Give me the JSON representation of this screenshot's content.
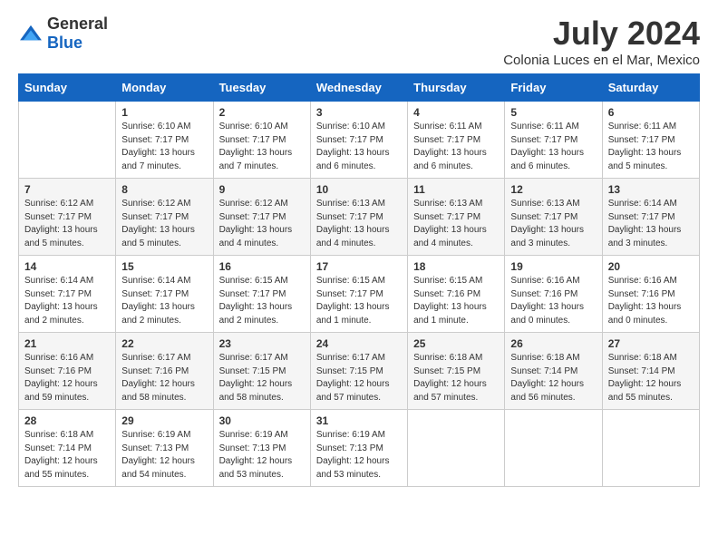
{
  "logo": {
    "general": "General",
    "blue": "Blue"
  },
  "header": {
    "month": "July 2024",
    "location": "Colonia Luces en el Mar, Mexico"
  },
  "weekdays": [
    "Sunday",
    "Monday",
    "Tuesday",
    "Wednesday",
    "Thursday",
    "Friday",
    "Saturday"
  ],
  "weeks": [
    [
      {
        "day": null,
        "sunrise": null,
        "sunset": null,
        "daylight": null
      },
      {
        "day": "1",
        "sunrise": "Sunrise: 6:10 AM",
        "sunset": "Sunset: 7:17 PM",
        "daylight": "Daylight: 13 hours and 7 minutes."
      },
      {
        "day": "2",
        "sunrise": "Sunrise: 6:10 AM",
        "sunset": "Sunset: 7:17 PM",
        "daylight": "Daylight: 13 hours and 7 minutes."
      },
      {
        "day": "3",
        "sunrise": "Sunrise: 6:10 AM",
        "sunset": "Sunset: 7:17 PM",
        "daylight": "Daylight: 13 hours and 6 minutes."
      },
      {
        "day": "4",
        "sunrise": "Sunrise: 6:11 AM",
        "sunset": "Sunset: 7:17 PM",
        "daylight": "Daylight: 13 hours and 6 minutes."
      },
      {
        "day": "5",
        "sunrise": "Sunrise: 6:11 AM",
        "sunset": "Sunset: 7:17 PM",
        "daylight": "Daylight: 13 hours and 6 minutes."
      },
      {
        "day": "6",
        "sunrise": "Sunrise: 6:11 AM",
        "sunset": "Sunset: 7:17 PM",
        "daylight": "Daylight: 13 hours and 5 minutes."
      }
    ],
    [
      {
        "day": "7",
        "sunrise": "Sunrise: 6:12 AM",
        "sunset": "Sunset: 7:17 PM",
        "daylight": "Daylight: 13 hours and 5 minutes."
      },
      {
        "day": "8",
        "sunrise": "Sunrise: 6:12 AM",
        "sunset": "Sunset: 7:17 PM",
        "daylight": "Daylight: 13 hours and 5 minutes."
      },
      {
        "day": "9",
        "sunrise": "Sunrise: 6:12 AM",
        "sunset": "Sunset: 7:17 PM",
        "daylight": "Daylight: 13 hours and 4 minutes."
      },
      {
        "day": "10",
        "sunrise": "Sunrise: 6:13 AM",
        "sunset": "Sunset: 7:17 PM",
        "daylight": "Daylight: 13 hours and 4 minutes."
      },
      {
        "day": "11",
        "sunrise": "Sunrise: 6:13 AM",
        "sunset": "Sunset: 7:17 PM",
        "daylight": "Daylight: 13 hours and 4 minutes."
      },
      {
        "day": "12",
        "sunrise": "Sunrise: 6:13 AM",
        "sunset": "Sunset: 7:17 PM",
        "daylight": "Daylight: 13 hours and 3 minutes."
      },
      {
        "day": "13",
        "sunrise": "Sunrise: 6:14 AM",
        "sunset": "Sunset: 7:17 PM",
        "daylight": "Daylight: 13 hours and 3 minutes."
      }
    ],
    [
      {
        "day": "14",
        "sunrise": "Sunrise: 6:14 AM",
        "sunset": "Sunset: 7:17 PM",
        "daylight": "Daylight: 13 hours and 2 minutes."
      },
      {
        "day": "15",
        "sunrise": "Sunrise: 6:14 AM",
        "sunset": "Sunset: 7:17 PM",
        "daylight": "Daylight: 13 hours and 2 minutes."
      },
      {
        "day": "16",
        "sunrise": "Sunrise: 6:15 AM",
        "sunset": "Sunset: 7:17 PM",
        "daylight": "Daylight: 13 hours and 2 minutes."
      },
      {
        "day": "17",
        "sunrise": "Sunrise: 6:15 AM",
        "sunset": "Sunset: 7:17 PM",
        "daylight": "Daylight: 13 hours and 1 minute."
      },
      {
        "day": "18",
        "sunrise": "Sunrise: 6:15 AM",
        "sunset": "Sunset: 7:16 PM",
        "daylight": "Daylight: 13 hours and 1 minute."
      },
      {
        "day": "19",
        "sunrise": "Sunrise: 6:16 AM",
        "sunset": "Sunset: 7:16 PM",
        "daylight": "Daylight: 13 hours and 0 minutes."
      },
      {
        "day": "20",
        "sunrise": "Sunrise: 6:16 AM",
        "sunset": "Sunset: 7:16 PM",
        "daylight": "Daylight: 13 hours and 0 minutes."
      }
    ],
    [
      {
        "day": "21",
        "sunrise": "Sunrise: 6:16 AM",
        "sunset": "Sunset: 7:16 PM",
        "daylight": "Daylight: 12 hours and 59 minutes."
      },
      {
        "day": "22",
        "sunrise": "Sunrise: 6:17 AM",
        "sunset": "Sunset: 7:16 PM",
        "daylight": "Daylight: 12 hours and 58 minutes."
      },
      {
        "day": "23",
        "sunrise": "Sunrise: 6:17 AM",
        "sunset": "Sunset: 7:15 PM",
        "daylight": "Daylight: 12 hours and 58 minutes."
      },
      {
        "day": "24",
        "sunrise": "Sunrise: 6:17 AM",
        "sunset": "Sunset: 7:15 PM",
        "daylight": "Daylight: 12 hours and 57 minutes."
      },
      {
        "day": "25",
        "sunrise": "Sunrise: 6:18 AM",
        "sunset": "Sunset: 7:15 PM",
        "daylight": "Daylight: 12 hours and 57 minutes."
      },
      {
        "day": "26",
        "sunrise": "Sunrise: 6:18 AM",
        "sunset": "Sunset: 7:14 PM",
        "daylight": "Daylight: 12 hours and 56 minutes."
      },
      {
        "day": "27",
        "sunrise": "Sunrise: 6:18 AM",
        "sunset": "Sunset: 7:14 PM",
        "daylight": "Daylight: 12 hours and 55 minutes."
      }
    ],
    [
      {
        "day": "28",
        "sunrise": "Sunrise: 6:18 AM",
        "sunset": "Sunset: 7:14 PM",
        "daylight": "Daylight: 12 hours and 55 minutes."
      },
      {
        "day": "29",
        "sunrise": "Sunrise: 6:19 AM",
        "sunset": "Sunset: 7:13 PM",
        "daylight": "Daylight: 12 hours and 54 minutes."
      },
      {
        "day": "30",
        "sunrise": "Sunrise: 6:19 AM",
        "sunset": "Sunset: 7:13 PM",
        "daylight": "Daylight: 12 hours and 53 minutes."
      },
      {
        "day": "31",
        "sunrise": "Sunrise: 6:19 AM",
        "sunset": "Sunset: 7:13 PM",
        "daylight": "Daylight: 12 hours and 53 minutes."
      },
      {
        "day": null,
        "sunrise": null,
        "sunset": null,
        "daylight": null
      },
      {
        "day": null,
        "sunrise": null,
        "sunset": null,
        "daylight": null
      },
      {
        "day": null,
        "sunrise": null,
        "sunset": null,
        "daylight": null
      }
    ]
  ]
}
